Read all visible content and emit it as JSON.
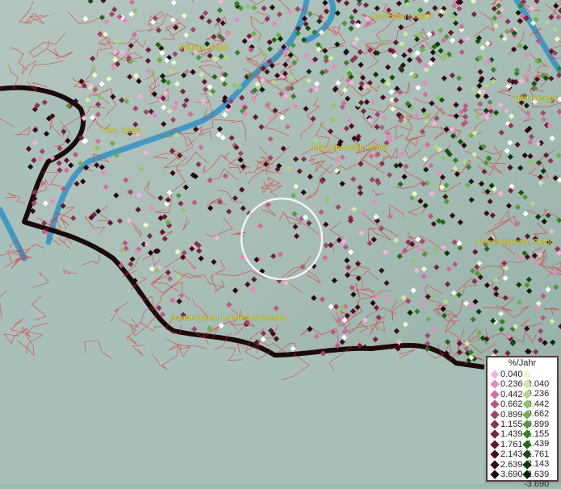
{
  "map": {
    "place_labels": [
      {
        "id": "kastellaun",
        "text": "Kastellaun, Stadt"
      },
      {
        "id": "wittlich",
        "text": "Wittlich, Stadt"
      },
      {
        "id": "trier",
        "text": "Trier, Stadt"
      },
      {
        "id": "idar",
        "text": "Idar-Oberstein, Stadt"
      },
      {
        "id": "badkreuz",
        "text": "Bad Kreuzn"
      },
      {
        "id": "kaisers",
        "text": "Kaiserslautern, Stadt"
      },
      {
        "id": "saarbr",
        "text": "Saarbrücken, Landeshauptstadt"
      }
    ],
    "colors": {
      "terrain": "#9fb8b0",
      "river": "#2a8fc4",
      "border": "#1a0a0a",
      "district_lines": "#e03030",
      "focus_ring": "#ffffff"
    }
  },
  "legend": {
    "title": "%/Jahr",
    "positive": [
      {
        "label": "0.040",
        "color": "#f3b3dc"
      },
      {
        "label": "0.236",
        "color": "#e48cc0"
      },
      {
        "label": "0.442",
        "color": "#cf6fa0"
      },
      {
        "label": "0.662",
        "color": "#b85a84"
      },
      {
        "label": "0.899",
        "color": "#a0476c"
      },
      {
        "label": "1.155",
        "color": "#8a3354"
      },
      {
        "label": "1.439",
        "color": "#742540"
      },
      {
        "label": "1.761",
        "color": "#5e1830"
      },
      {
        "label": "2.143",
        "color": "#4a0f22"
      },
      {
        "label": "2.639",
        "color": "#360818"
      },
      {
        "label": "3.690",
        "color": "#200410"
      }
    ],
    "negative": [
      {
        "label": "-0.040",
        "color": "#eef7c8"
      },
      {
        "label": "-0.236",
        "color": "#cfe8a4"
      },
      {
        "label": "-0.442",
        "color": "#b0d888"
      },
      {
        "label": "-0.662",
        "color": "#90c46c"
      },
      {
        "label": "-0.899",
        "color": "#70ae52"
      },
      {
        "label": "-1.155",
        "color": "#52963c"
      },
      {
        "label": "-1.439",
        "color": "#3a7e2a"
      },
      {
        "label": "-1.761",
        "color": "#26661c"
      },
      {
        "label": "-2.143",
        "color": "#164e12"
      },
      {
        "label": "-2.639",
        "color": "#0c380a"
      },
      {
        "label": "-3.690",
        "color": "#062204"
      }
    ]
  }
}
